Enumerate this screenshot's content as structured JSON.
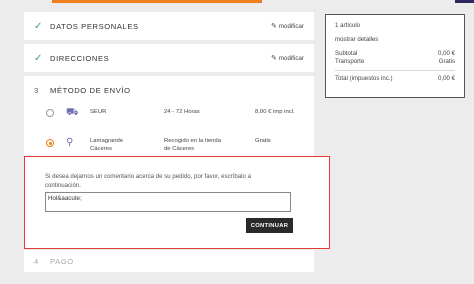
{
  "steps": {
    "personal": {
      "title": "DATOS PERSONALES",
      "edit": "modificar"
    },
    "addresses": {
      "title": "DIRECCIONES",
      "edit": "modificar"
    },
    "shipping": {
      "number": "3",
      "title": "MÉTODO DE ENVÍO"
    },
    "payment": {
      "number": "4",
      "title": "PAGO"
    }
  },
  "carriers": [
    {
      "name": "SEUR",
      "name2": "",
      "delay": "24 - 72 Horas",
      "delay2": "",
      "price": "8,00 € imp incl.",
      "selected": false,
      "icon": "truck-icon"
    },
    {
      "name": "Lamagrande",
      "name2": "Cáceres",
      "delay": "Recogido en la tienda",
      "delay2": "de Cáceres",
      "price": "Gratis",
      "selected": true,
      "icon": "store-pickup-icon"
    }
  ],
  "comment": {
    "label": "Si desea dejarnos un comentario acerca de su pedido, por favor, escríbalo a continuación.",
    "value": "Hol&aacute;",
    "button": "CONTINUAR"
  },
  "summary": {
    "items_count": "1 artículo",
    "details_link": "mostrar detalles",
    "subtotal_label": "Subtotal",
    "subtotal_value": "0,00 €",
    "shipping_label": "Transporte",
    "shipping_value": "Gratis",
    "total_label": "Total (impuestos inc.)",
    "total_value": "0,00 €"
  },
  "colors": {
    "accent": "#ef7f1a",
    "success": "#3fa35a",
    "highlight": "#e43a3a"
  }
}
